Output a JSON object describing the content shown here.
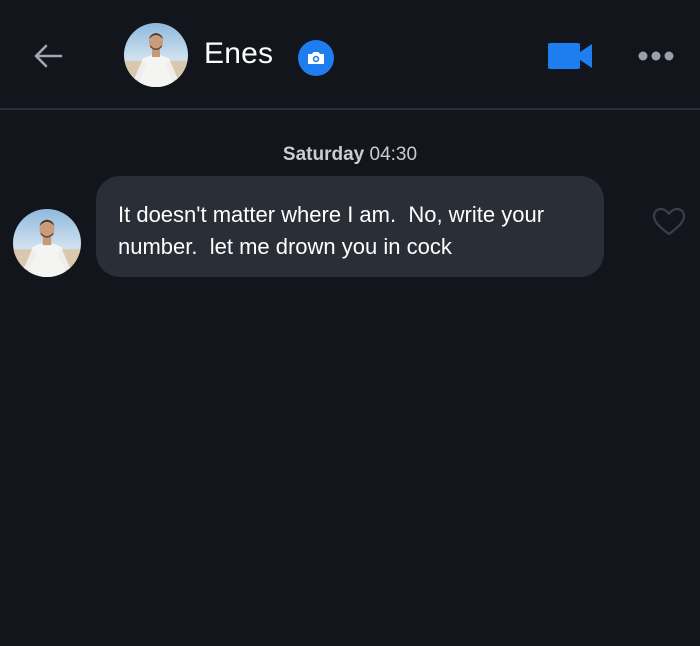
{
  "header": {
    "contact_name": "Enes",
    "icons": {
      "back": "arrow-left-icon",
      "camera": "camera-icon",
      "video_call": "video-camera-icon",
      "more": "more-horizontal-icon"
    }
  },
  "conversation": {
    "timestamp": {
      "day": "Saturday",
      "time": "04:30"
    },
    "messages": [
      {
        "text": "It doesn't matter where I am.  No, write your number.  let me drown you in cock",
        "reaction_icon": "heart-outline-icon"
      }
    ]
  },
  "colors": {
    "background": "#12151b",
    "bubble": "#2a2e36",
    "accent": "#1e7ef0",
    "muted_text": "#c9ccd2"
  }
}
